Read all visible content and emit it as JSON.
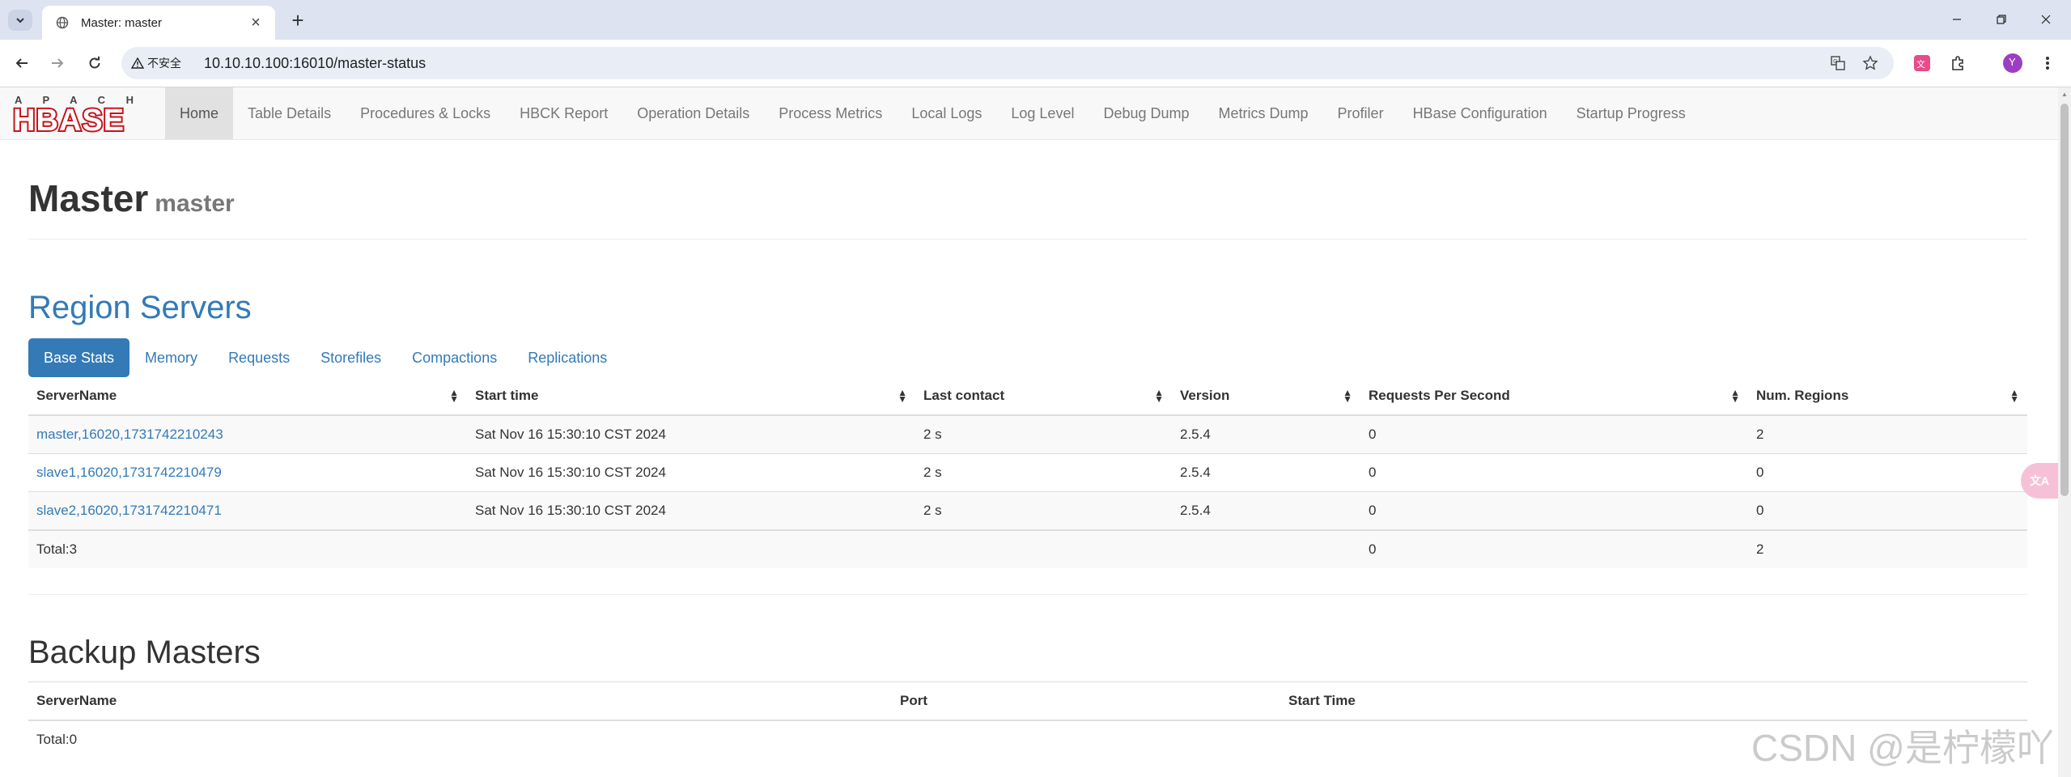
{
  "browser": {
    "tab_title": "Master: master",
    "tab_close": "×",
    "new_tab": "+",
    "security_label": "不安全",
    "url": "10.10.10.100:16010/master-status",
    "profile_initial": "Y"
  },
  "navbar": {
    "brand_top": "A P A C H E",
    "brand_main": "HBASE",
    "items": [
      {
        "label": "Home",
        "active": true
      },
      {
        "label": "Table Details"
      },
      {
        "label": "Procedures & Locks"
      },
      {
        "label": "HBCK Report"
      },
      {
        "label": "Operation Details"
      },
      {
        "label": "Process Metrics"
      },
      {
        "label": "Local Logs"
      },
      {
        "label": "Log Level"
      },
      {
        "label": "Debug Dump"
      },
      {
        "label": "Metrics Dump"
      },
      {
        "label": "Profiler"
      },
      {
        "label": "HBase Configuration"
      },
      {
        "label": "Startup Progress"
      }
    ]
  },
  "page": {
    "title": "Master",
    "subtitle": "master"
  },
  "region_servers": {
    "title": "Region Servers",
    "tabs": [
      "Base Stats",
      "Memory",
      "Requests",
      "Storefiles",
      "Compactions",
      "Replications"
    ],
    "columns": [
      "ServerName",
      "Start time",
      "Last contact",
      "Version",
      "Requests Per Second",
      "Num. Regions"
    ],
    "rows": [
      [
        "master,16020,1731742210243",
        "Sat Nov 16 15:30:10 CST 2024",
        "2 s",
        "2.5.4",
        "0",
        "2"
      ],
      [
        "slave1,16020,1731742210479",
        "Sat Nov 16 15:30:10 CST 2024",
        "2 s",
        "2.5.4",
        "0",
        "0"
      ],
      [
        "slave2,16020,1731742210471",
        "Sat Nov 16 15:30:10 CST 2024",
        "2 s",
        "2.5.4",
        "0",
        "0"
      ]
    ],
    "total": {
      "label": "Total:3",
      "requests": "0",
      "regions": "2"
    }
  },
  "backup_masters": {
    "title": "Backup Masters",
    "columns": [
      "ServerName",
      "Port",
      "Start Time"
    ],
    "total": "Total:0"
  },
  "floating_button": "文A",
  "watermark": "CSDN @是柠檬吖"
}
